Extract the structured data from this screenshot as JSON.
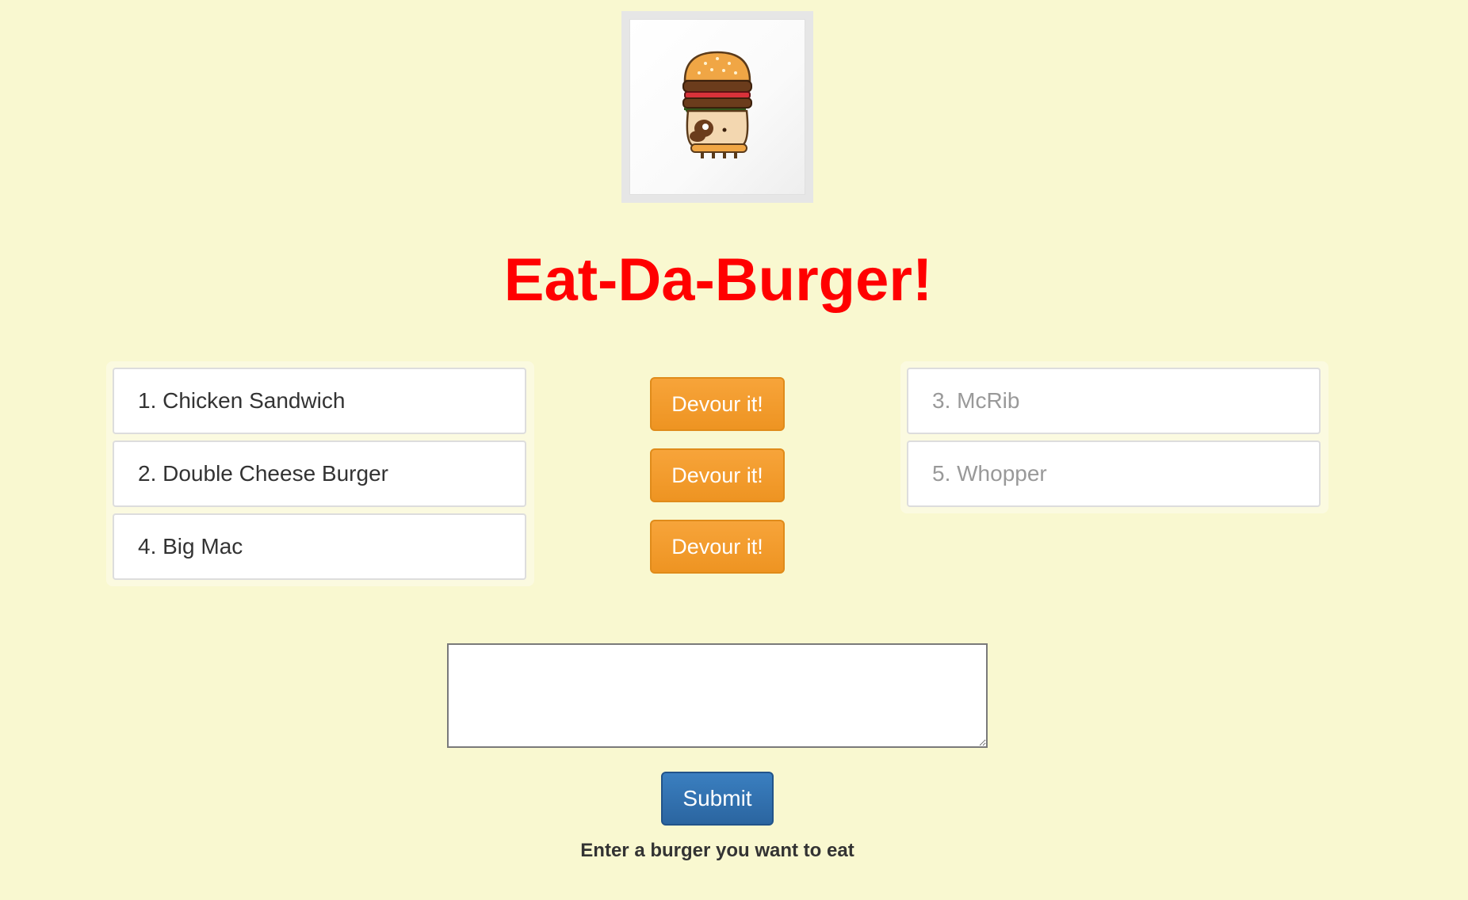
{
  "header": {
    "logo_icon": "pug-burger-icon",
    "title": "Eat-Da-Burger!"
  },
  "burgers_to_eat": [
    {
      "label": "1. Chicken Sandwich",
      "button_label": "Devour it!"
    },
    {
      "label": "2. Double Cheese Burger",
      "button_label": "Devour it!"
    },
    {
      "label": "4. Big Mac",
      "button_label": "Devour it!"
    }
  ],
  "burgers_devoured": [
    {
      "label": "3. McRib"
    },
    {
      "label": "5. Whopper"
    }
  ],
  "form": {
    "input_value": "",
    "submit_label": "Submit",
    "hint": "Enter a burger you want to eat"
  },
  "colors": {
    "background": "#f9f8d0",
    "title": "#ff0000",
    "devour_button": "#f0982a",
    "submit_button": "#2f6fad"
  }
}
